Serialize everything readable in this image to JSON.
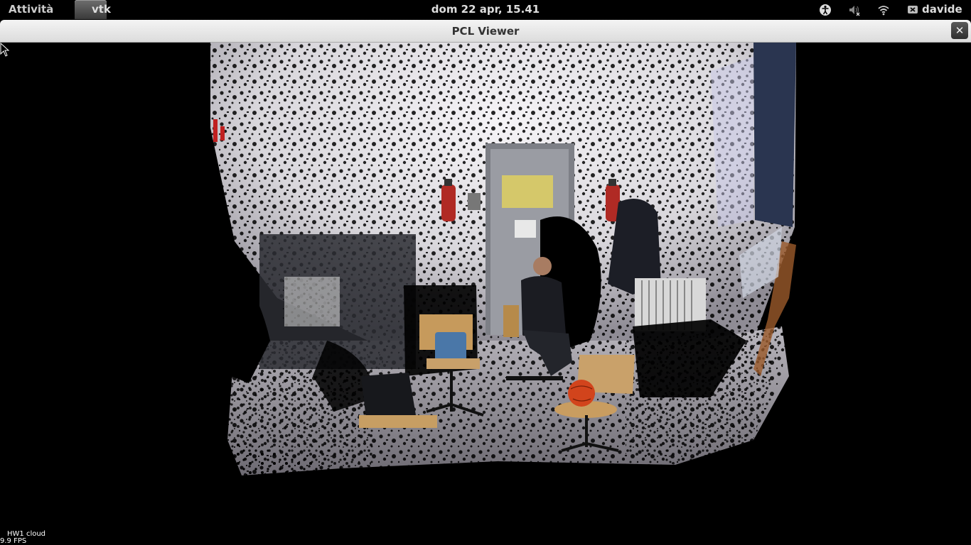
{
  "topbar": {
    "activities": "Attività",
    "app_name": "vtk",
    "clock": "dom 22 apr, 15.41",
    "icons": [
      "accessibility-icon",
      "volume-muted-icon",
      "wifi-icon",
      "chat-offline-icon"
    ],
    "user": "davide"
  },
  "window": {
    "title": "PCL Viewer",
    "close_glyph": "✕"
  },
  "viewer": {
    "cloud_label": "HW1 cloud",
    "fps": "9.9 FPS"
  }
}
